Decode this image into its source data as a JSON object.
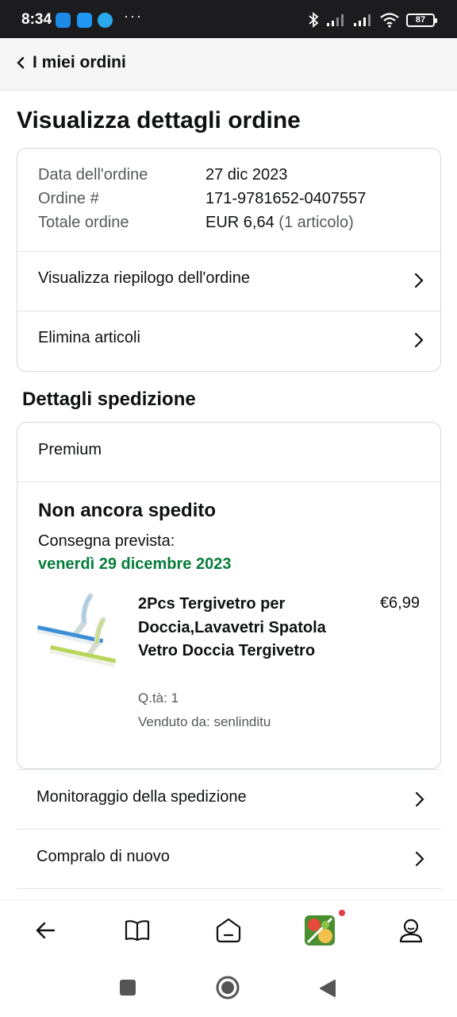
{
  "status_bar": {
    "time": "8:34",
    "dots": "···",
    "battery": "87"
  },
  "top_nav": {
    "back_icon": "chevron-left-icon",
    "title": "I miei ordini"
  },
  "page_title": "Visualizza dettagli ordine",
  "order_summary": {
    "date_label": "Data dell'ordine",
    "date_value": "27 dic 2023",
    "order_label": "Ordine #",
    "order_value": "171-9781652-0407557",
    "total_label": "Totale ordine",
    "total_value": "EUR 6,64",
    "total_items": "(1 articolo)",
    "links": [
      {
        "label": "Visualizza riepilogo dell'ordine"
      },
      {
        "label": "Elimina articoli"
      }
    ]
  },
  "shipping": {
    "section_title": "Dettagli spedizione",
    "service": "Premium",
    "status": "Non ancora spedito",
    "delivery_label": "Consegna prevista:",
    "delivery_date": "venerdì 29 dicembre 2023",
    "delivery_date_color": "#067d3a",
    "item": {
      "name": "2Pcs Tergivetro per Doccia,Lavavetri Spatola Vetro Doccia Tergivetro",
      "price": "€6,99",
      "quantity": "Q.tà: 1",
      "seller": "Venduto da: senlinditu"
    }
  },
  "actions": [
    {
      "label": "Monitoraggio della spedizione"
    },
    {
      "label": "Compralo di nuovo"
    }
  ],
  "bottom_nav": {
    "items": [
      "back-arrow-icon",
      "book-icon",
      "home-icon",
      "game-app-icon",
      "profile-icon"
    ]
  },
  "system_nav": [
    "recents-square-icon",
    "home-circle-icon",
    "back-triangle-icon"
  ]
}
